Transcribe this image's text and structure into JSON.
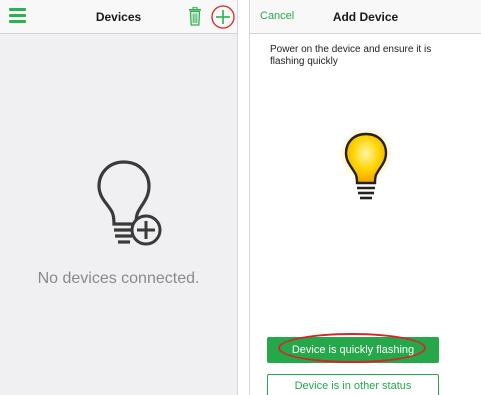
{
  "devices_screen": {
    "title": "Devices",
    "empty_message": "No devices connected.",
    "icons": {
      "menu": "hamburger-menu-icon",
      "delete": "trash-icon",
      "add": "plus-icon",
      "empty_state": "lightbulb-plus-icon"
    }
  },
  "add_device_screen": {
    "title": "Add Device",
    "cancel_label": "Cancel",
    "instruction": "Power on the device and ensure it is flashing quickly",
    "primary_button": "Device is quickly flashing",
    "secondary_button": "Device is in other status",
    "icons": {
      "bulb": "lit-lightbulb-icon"
    }
  },
  "colors": {
    "accent_green": "#24a84a",
    "highlight_red": "#d8232a",
    "bulb_yellow": "#ffd400"
  }
}
